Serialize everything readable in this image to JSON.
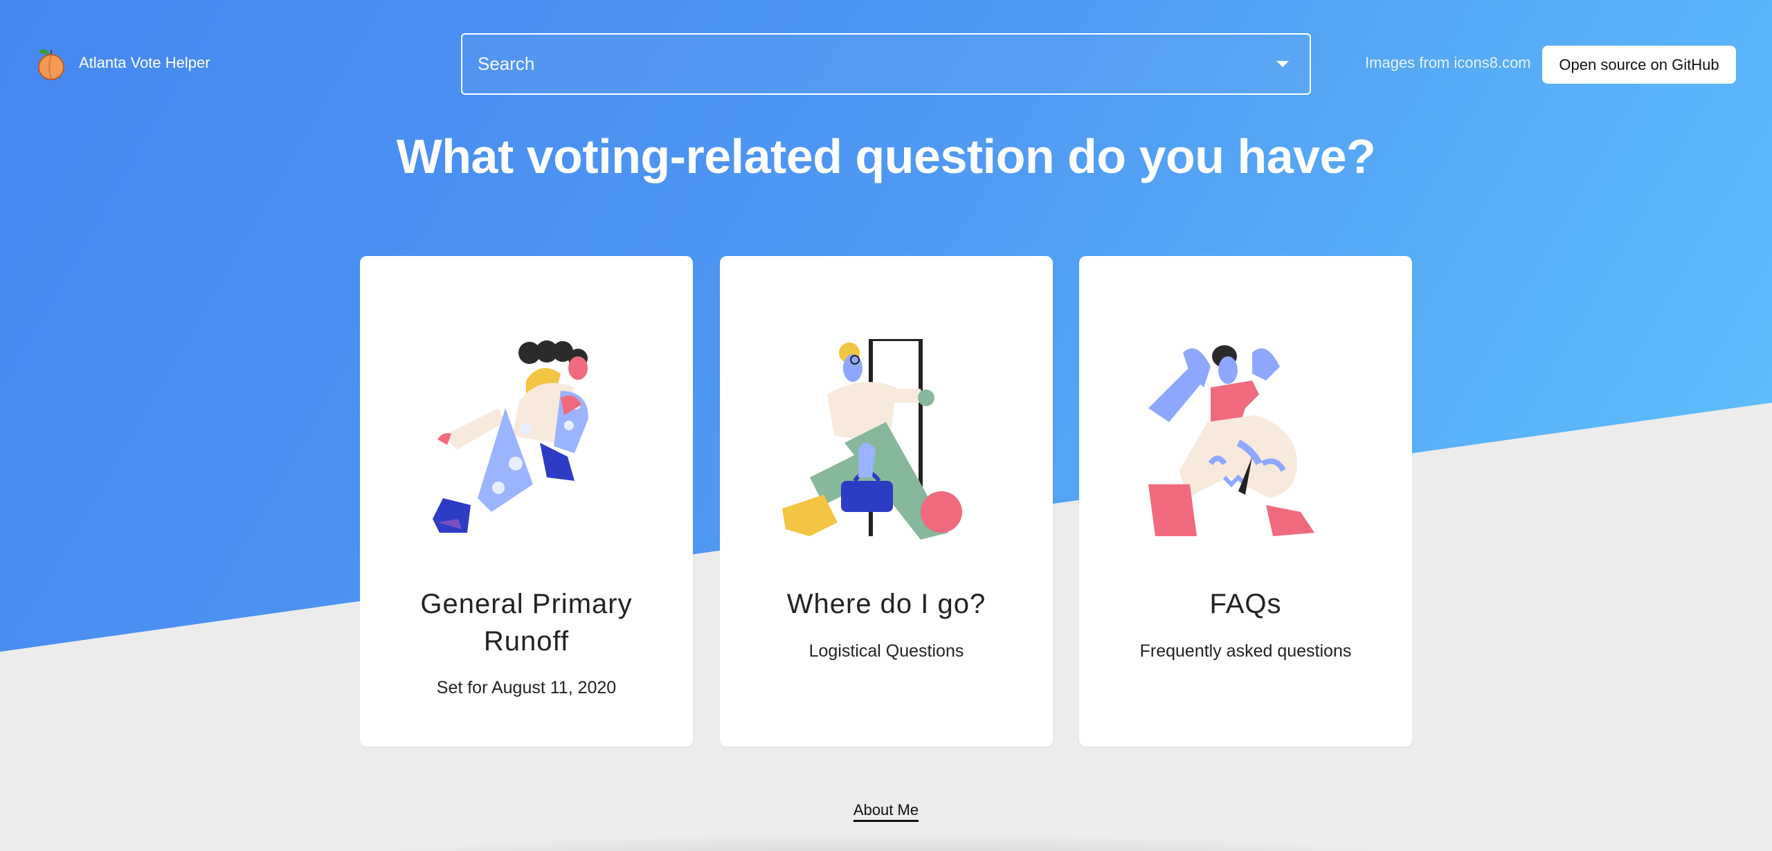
{
  "header": {
    "brand": "Atlanta Vote Helper",
    "search_placeholder": "Search",
    "credit": "Images from icons8.com",
    "github_label": "Open source on GitHub"
  },
  "main": {
    "headline": "What voting-related question do you have?",
    "cards": [
      {
        "title": "General Primary Runoff",
        "subtitle": "Set for August 11, 2020"
      },
      {
        "title": "Where do I go?",
        "subtitle": "Logistical Questions"
      },
      {
        "title": "FAQs",
        "subtitle": "Frequently asked questions"
      }
    ]
  },
  "footer": {
    "about_label": "About Me"
  },
  "colors": {
    "gradient_start": "#4588f1",
    "gradient_end": "#62c6fc",
    "page_bg": "#ececec",
    "card_bg": "#ffffff"
  },
  "icons": [
    "peach-logo-icon",
    "dropdown-caret-icon"
  ]
}
